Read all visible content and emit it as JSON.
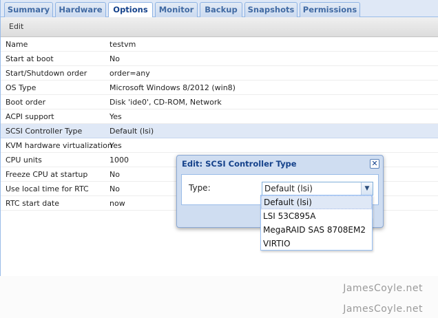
{
  "tabs": [
    "Summary",
    "Hardware",
    "Options",
    "Monitor",
    "Backup",
    "Snapshots",
    "Permissions"
  ],
  "active_tab": "Options",
  "toolbar": {
    "edit_label": "Edit"
  },
  "options": [
    {
      "name": "Name",
      "value": "testvm"
    },
    {
      "name": "Start at boot",
      "value": "No"
    },
    {
      "name": "Start/Shutdown order",
      "value": "order=any"
    },
    {
      "name": "OS Type",
      "value": "Microsoft Windows 8/2012 (win8)"
    },
    {
      "name": "Boot order",
      "value": "Disk 'ide0', CD-ROM, Network"
    },
    {
      "name": "ACPI support",
      "value": "Yes"
    },
    {
      "name": "SCSI Controller Type",
      "value": "Default (lsi)"
    },
    {
      "name": "KVM hardware virtualization",
      "value": "Yes"
    },
    {
      "name": "CPU units",
      "value": "1000"
    },
    {
      "name": "Freeze CPU at startup",
      "value": "No"
    },
    {
      "name": "Use local time for RTC",
      "value": "No"
    },
    {
      "name": "RTC start date",
      "value": "now"
    }
  ],
  "selected_row": "SCSI Controller Type",
  "dialog": {
    "title": "Edit: SCSI Controller Type",
    "close_icon": "close-icon",
    "type_label": "Type:",
    "type_value": "Default (lsi)",
    "dropdown_options": [
      "Default (lsi)",
      "LSI 53C895A",
      "MegaRAID SAS 8708EM2",
      "VIRTIO"
    ]
  },
  "watermarks": [
    "JamesCoyle.net",
    "JamesCoyle.net"
  ]
}
